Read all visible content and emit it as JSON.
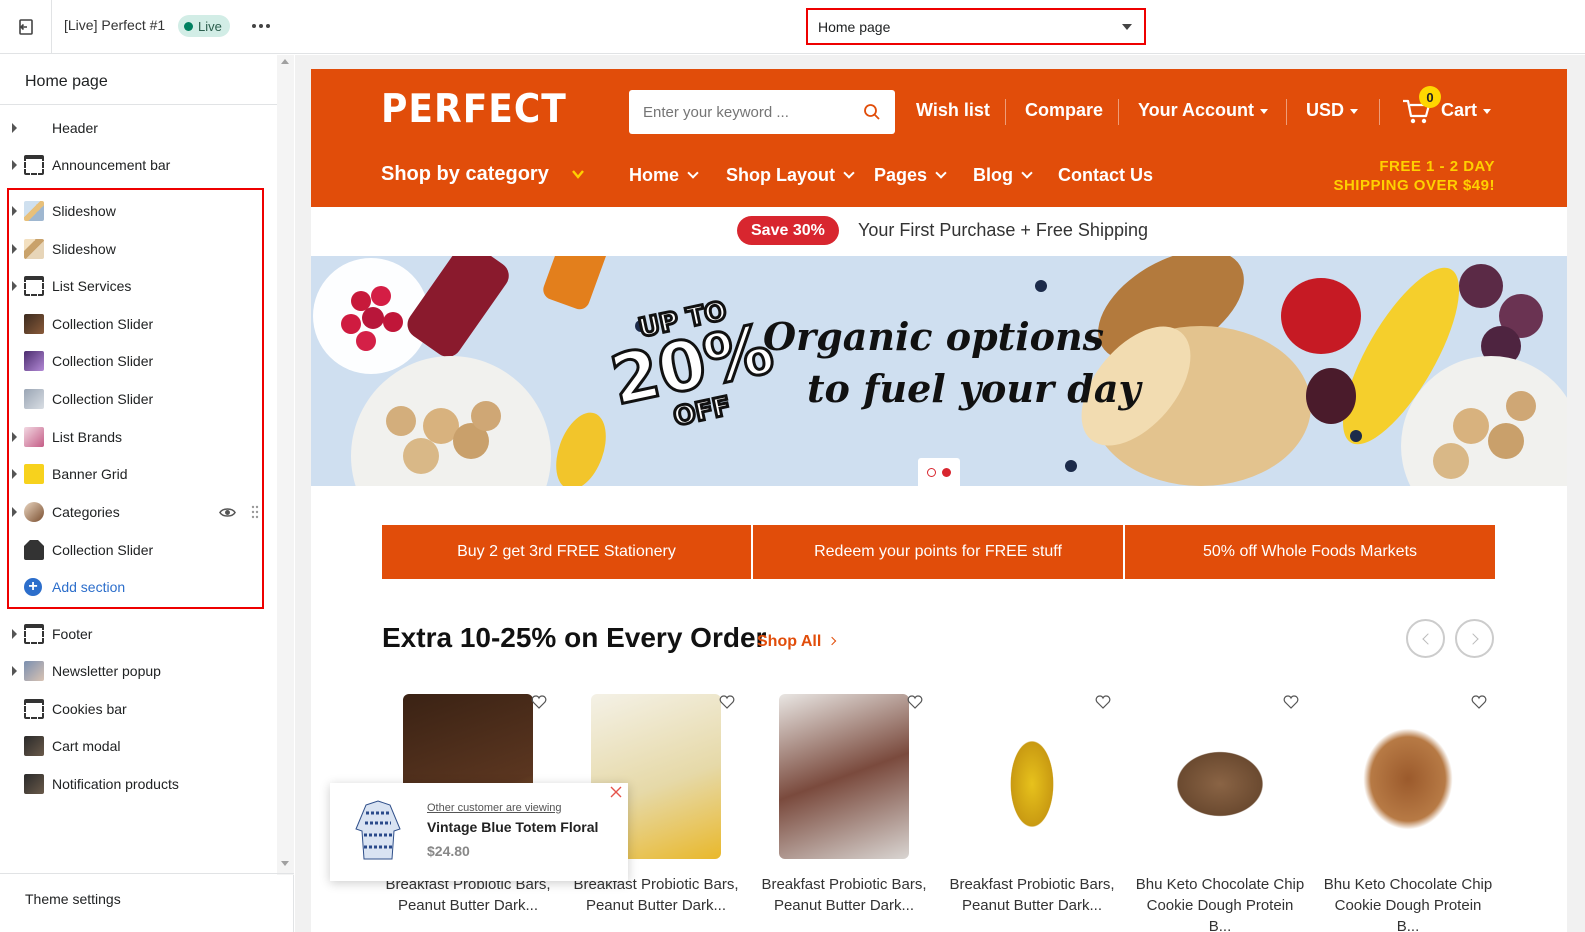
{
  "topbar": {
    "theme_name": "[Live] Perfect #1",
    "live_label": "Live",
    "page_select": "Home page"
  },
  "sidebar": {
    "title": "Home page",
    "items": [
      {
        "label": "Header"
      },
      {
        "label": "Announcement bar"
      },
      {
        "label": "Slideshow"
      },
      {
        "label": "Slideshow"
      },
      {
        "label": "List Services"
      },
      {
        "label": "Collection Slider"
      },
      {
        "label": "Collection Slider"
      },
      {
        "label": "Collection Slider"
      },
      {
        "label": "List Brands"
      },
      {
        "label": "Banner Grid"
      },
      {
        "label": "Categories"
      },
      {
        "label": "Collection Slider"
      },
      {
        "label": "Footer"
      },
      {
        "label": "Newsletter popup"
      },
      {
        "label": "Cookies bar"
      },
      {
        "label": "Cart modal"
      },
      {
        "label": "Notification products"
      }
    ],
    "add_section": "Add section",
    "theme_settings": "Theme settings"
  },
  "store": {
    "logo": "PERFECT",
    "search_placeholder": "Enter your keyword ...",
    "header_links": {
      "wishlist": "Wish list",
      "compare": "Compare",
      "account": "Your Account",
      "currency": "USD",
      "cart": "Cart",
      "cart_count": "0"
    },
    "shop_by_category": "Shop by category",
    "main_nav": [
      "Home",
      "Shop Layout",
      "Pages",
      "Blog",
      "Contact Us"
    ],
    "shipping_line1": "FREE 1 - 2 DAY",
    "shipping_line2": "SHIPPING OVER $49!",
    "announcement": {
      "badge": "Save 30%",
      "text": "Your First Purchase + Free Shipping"
    },
    "slide": {
      "promo_top": "UP TO",
      "promo_big": "20%",
      "promo_bottom": "OFF",
      "headline_1": "Organic options",
      "headline_2": "to fuel your day"
    },
    "services": [
      "Buy 2 get 3rd FREE Stationery",
      "Redeem your points for FREE stuff",
      "50% off Whole Foods Markets"
    ],
    "section": {
      "title": "Extra 10-25% on Every Order",
      "shop_all": "Shop All"
    },
    "products": [
      {
        "name_1": "Breakfast Probiotic Bars,",
        "name_2": "Peanut Butter Dark..."
      },
      {
        "name_1": "Breakfast Probiotic Bars,",
        "name_2": "Peanut Butter Dark..."
      },
      {
        "name_1": "Breakfast Probiotic Bars,",
        "name_2": "Peanut Butter Dark..."
      },
      {
        "name_1": "Breakfast Probiotic Bars,",
        "name_2": "Peanut Butter Dark..."
      },
      {
        "name_1": "Bhu Keto Chocolate Chip",
        "name_2": "Cookie Dough Protein B..."
      },
      {
        "name_1": "Bhu Keto Chocolate Chip",
        "name_2": "Cookie Dough Protein B..."
      }
    ],
    "popup": {
      "viewing": "Other customer are viewing",
      "product": "Vintage Blue Totem Floral",
      "price": "$24.80"
    }
  },
  "colors": {
    "brand_orange": "#e14d0a",
    "accent_yellow": "#ffd000",
    "sale_red": "#d8262f",
    "editor_link": "#2c6ecb",
    "highlight_frame": "#e00000"
  }
}
